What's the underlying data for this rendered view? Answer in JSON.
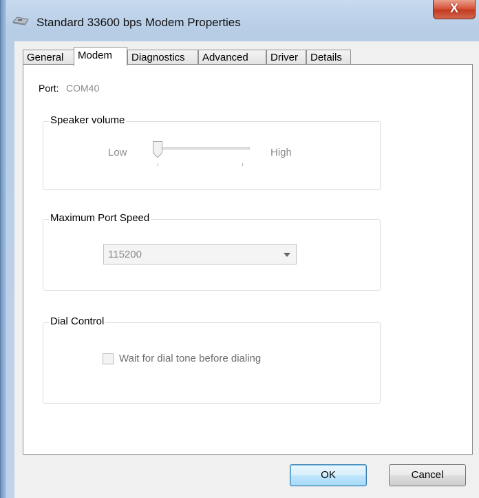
{
  "window": {
    "title": "Standard 33600 bps Modem Properties",
    "close_glyph": "X"
  },
  "tabs": [
    {
      "label": "General"
    },
    {
      "label": "Modem"
    },
    {
      "label": "Diagnostics"
    },
    {
      "label": "Advanced"
    },
    {
      "label": "Driver"
    },
    {
      "label": "Details"
    }
  ],
  "active_tab": "Modem",
  "port": {
    "label": "Port:",
    "value": "COM40"
  },
  "speaker_volume": {
    "group_title": "Speaker volume",
    "low_label": "Low",
    "high_label": "High",
    "level": 0,
    "enabled": false
  },
  "max_port_speed": {
    "group_title": "Maximum Port Speed",
    "selected": "115200",
    "enabled": false
  },
  "dial_control": {
    "group_title": "Dial Control",
    "checkbox_label": "Wait for dial tone before dialing",
    "checked": false,
    "enabled": false
  },
  "buttons": {
    "ok": "OK",
    "cancel": "Cancel"
  },
  "colors": {
    "close_button": "#c33a1f",
    "disabled_text": "#8b8b8b",
    "default_button_border": "#3c7fb1"
  },
  "icons": [
    "modem-icon",
    "close-icon",
    "chevron-down-icon"
  ]
}
